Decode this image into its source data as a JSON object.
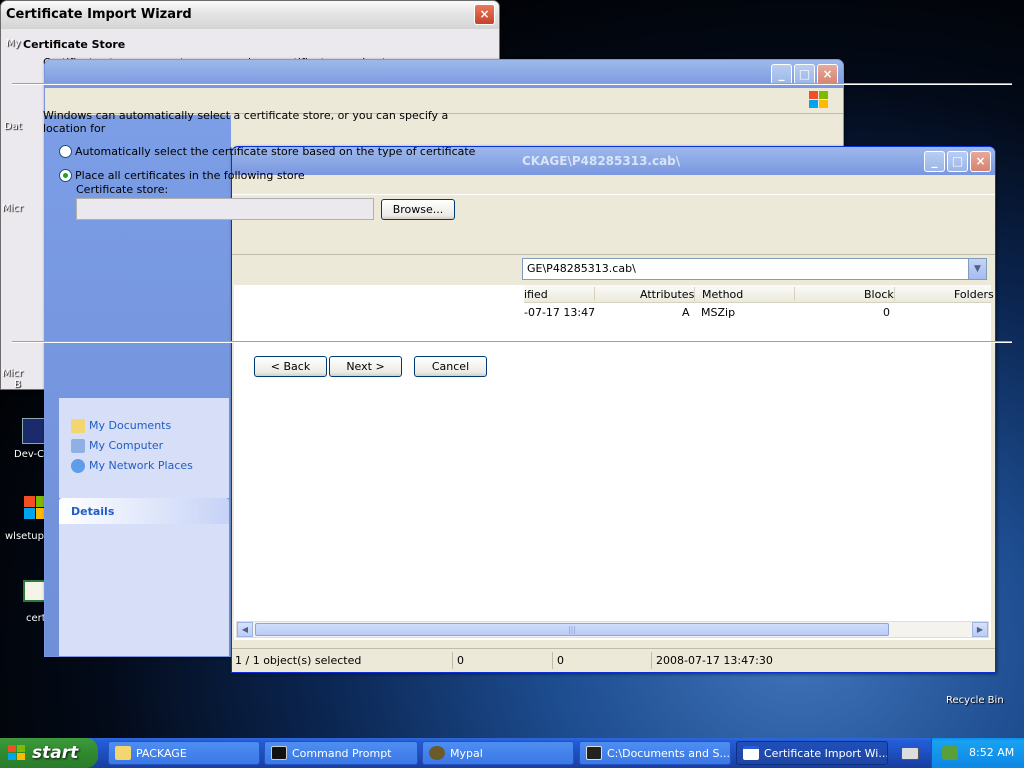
{
  "desktop": {
    "icons": [
      {
        "label": "My"
      },
      {
        "label": "Dat"
      },
      {
        "label": "Micr"
      },
      {
        "label": "Micr"
      },
      {
        "label": "B"
      },
      {
        "label": "Dev-C"
      },
      {
        "label": "wlsetup"
      },
      {
        "label": "cert"
      },
      {
        "label": "Recycle Bin"
      }
    ]
  },
  "wizard": {
    "title": "Certificate Import Wizard",
    "header_title": "Certificate Store",
    "header_subtitle": "Certificate stores are system areas where certificates are kept.",
    "intro": "Windows can automatically select a certificate store, or you can specify a location for",
    "radio_auto": "Automatically select the certificate store based on the type of certificate",
    "radio_place": "Place all certificates in the following store",
    "store_label": "Certificate store:",
    "store_value": "",
    "browse": "Browse...",
    "back": "< Back",
    "next": "Next >",
    "cancel": "Cancel"
  },
  "cab_window": {
    "title": "CKAGE\\P48285313.cab\\",
    "address": "GE\\P48285313.cab\\",
    "columns": [
      "ified",
      "Attributes",
      "Method",
      "Block",
      "Folders"
    ],
    "rows": [
      {
        "modified": "-07-17 13:47",
        "attributes": "A",
        "method": "MSZip",
        "block": "0"
      }
    ],
    "scroll_thumb": "|||",
    "status": {
      "selected": "1 / 1 object(s) selected",
      "size": "0",
      "packed": "0",
      "date": "2008-07-17 13:47:30"
    }
  },
  "explorer_panel": {
    "links": [
      "My Documents",
      "My Computer",
      "My Network Places"
    ],
    "details_title": "Details"
  },
  "taskbar": {
    "start": "start",
    "tasks": [
      {
        "label": "PACKAGE"
      },
      {
        "label": "Command Prompt"
      },
      {
        "label": "Mypal"
      },
      {
        "label": "C:\\Documents and S..."
      },
      {
        "label": "Certificate Import Wi..."
      }
    ],
    "clock": "8:52 AM"
  }
}
